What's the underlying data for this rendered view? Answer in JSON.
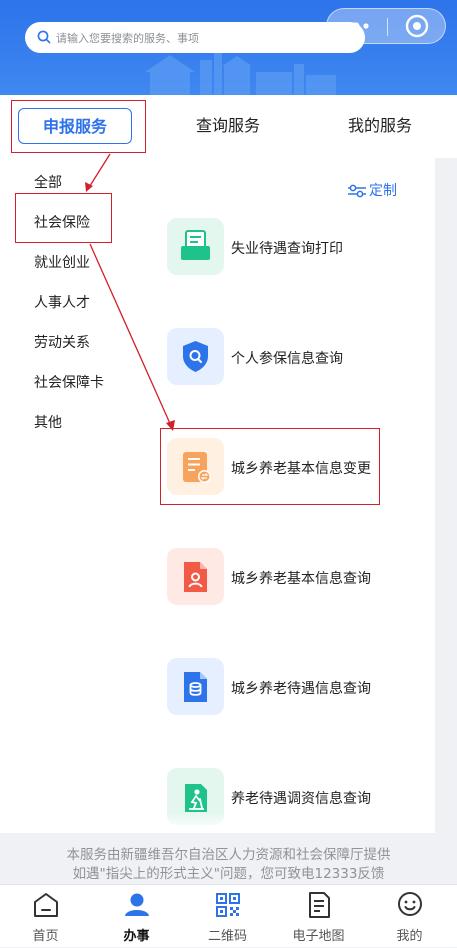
{
  "search": {
    "placeholder": "请输入您要搜索的服务、事项"
  },
  "tabs": [
    {
      "label": "申报服务"
    },
    {
      "label": "查询服务"
    },
    {
      "label": "我的服务"
    }
  ],
  "sidebar": {
    "items": [
      {
        "label": "全部"
      },
      {
        "label": "社会保险"
      },
      {
        "label": "就业创业"
      },
      {
        "label": "人事人才"
      },
      {
        "label": "劳动关系"
      },
      {
        "label": "社会保障卡"
      },
      {
        "label": "其他"
      }
    ]
  },
  "customize_label": "定制",
  "services": [
    {
      "label": "失业待遇查询打印",
      "icon": "print-document-icon"
    },
    {
      "label": "个人参保信息查询",
      "icon": "shield-search-icon"
    },
    {
      "label": "城乡养老基本信息变更",
      "icon": "document-exchange-icon"
    },
    {
      "label": "城乡养老基本信息查询",
      "icon": "person-file-icon"
    },
    {
      "label": "城乡养老待遇信息查询",
      "icon": "coin-file-icon"
    },
    {
      "label": "养老待遇调资信息查询",
      "icon": "elder-icon"
    }
  ],
  "footer": {
    "line1": "本服务由新疆维吾尔自治区人力资源和社会保障厅提供",
    "line2": "如遇\"指尖上的形式主义\"问题，您可致电12333反馈"
  },
  "bottom_nav": [
    {
      "label": "首页",
      "icon": "home-icon"
    },
    {
      "label": "办事",
      "icon": "person-icon"
    },
    {
      "label": "二维码",
      "icon": "qr-code-icon"
    },
    {
      "label": "电子地图",
      "icon": "map-icon"
    },
    {
      "label": "我的",
      "icon": "smile-icon"
    }
  ],
  "colors": {
    "accent": "#2d73ea",
    "annotation": "#d3202a",
    "header_bg": "#3f88f0"
  }
}
